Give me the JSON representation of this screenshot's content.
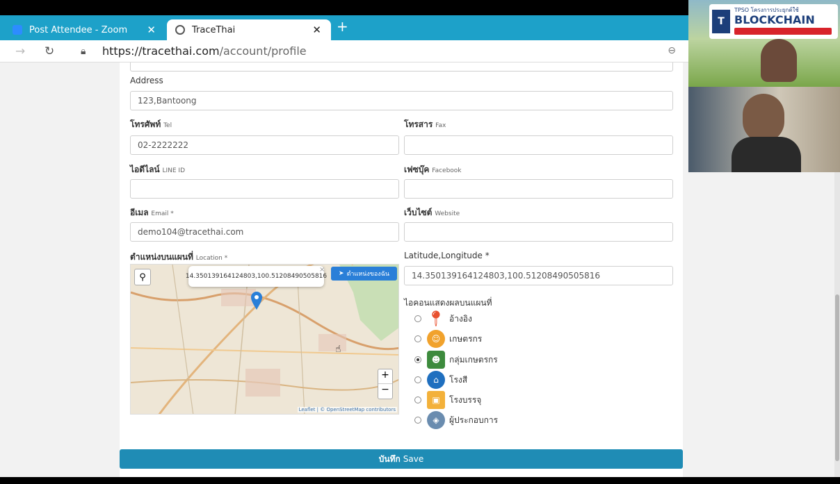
{
  "browser": {
    "tabs": [
      {
        "label": "Post Attendee - Zoom",
        "icon": "zoom-icon"
      },
      {
        "label": "TraceThai",
        "icon": "tracethai-icon"
      }
    ],
    "url_host": "https://tracethai.com",
    "url_path": "/account/profile"
  },
  "form": {
    "address_label": "Address",
    "address_value": "123,Bantoong",
    "tel_label_th": "โทรศัพท์",
    "tel_label_en": "Tel",
    "tel_value": "02-2222222",
    "fax_label_th": "โทรสาร",
    "fax_label_en": "Fax",
    "fax_value": "",
    "line_label_th": "ไอดีไลน์",
    "line_label_en": "LINE ID",
    "line_value": "",
    "facebook_label_th": "เฟซบุ๊ค",
    "facebook_label_en": "Facebook",
    "facebook_value": "",
    "email_label_th": "อีเมล",
    "email_label_en": "Email *",
    "email_value": "demo104@tracethai.com",
    "website_label_th": "เว็บไซต์",
    "website_label_en": "Website",
    "website_value": "",
    "location_label_th": "ตำแหน่งบนแผนที่",
    "location_label_en": "Location *",
    "latlng_label": "Latitude,Longitude *",
    "latlng_value": "14.350139164124803,100.51208490505816",
    "icon_label": "ไอคอนแสดงผลบนแผนที่",
    "save_th": "บันทึก",
    "save_en": "Save"
  },
  "map": {
    "popup_text": "14.350139164124803,100.51208490505816",
    "my_location_btn": "ตำแหน่งของฉัน",
    "zoom_in": "+",
    "zoom_out": "−",
    "attribution": "Leaflet | © OpenStreetMap contributors"
  },
  "icon_options": [
    {
      "label": "อ้างอิง",
      "selected": false,
      "icon": "map-pin-icon",
      "color": "#e8502f"
    },
    {
      "label": "เกษตรกร",
      "selected": false,
      "icon": "farmer-icon",
      "color": "#f1a22c"
    },
    {
      "label": "กลุ่มเกษตรกร",
      "selected": true,
      "icon": "farmer-group-icon",
      "color": "#3d8b3d"
    },
    {
      "label": "โรงสี",
      "selected": false,
      "icon": "mill-icon",
      "color": "#1f6fbf"
    },
    {
      "label": "โรงบรรจุ",
      "selected": false,
      "icon": "packing-icon",
      "color": "#f3b13a"
    },
    {
      "label": "ผู้ประกอบการ",
      "selected": false,
      "icon": "entrepreneur-icon",
      "color": "#6a8caf"
    }
  ],
  "video_overlay": {
    "brand": "BLOCKCHAIN",
    "org": "TPSO",
    "subtitle": "โครงการประยุกต์ใช้"
  }
}
